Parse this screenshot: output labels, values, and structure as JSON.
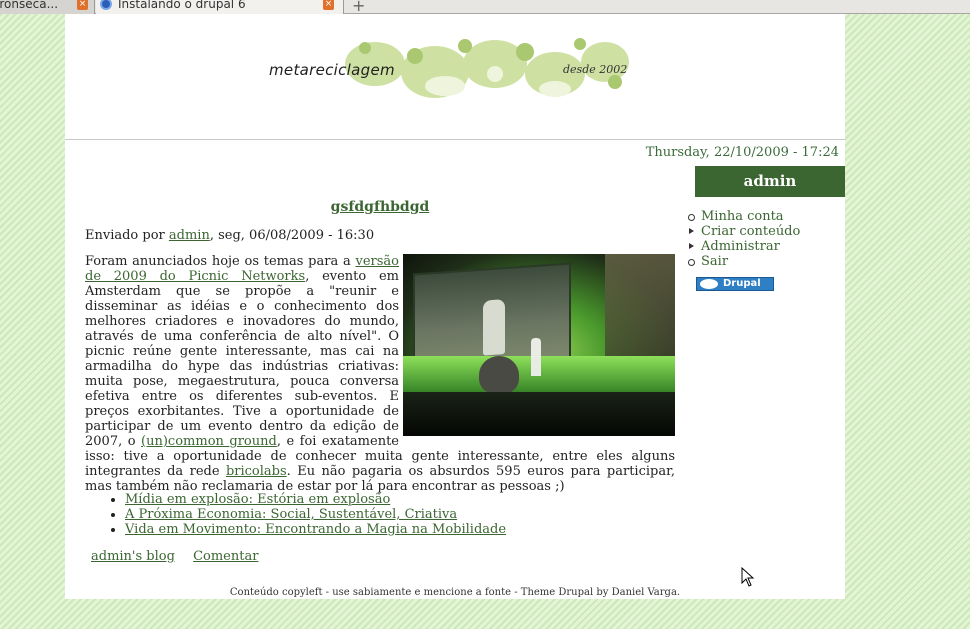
{
  "browser": {
    "tabs": [
      {
        "label": "eronseca..."
      },
      {
        "label": "Instalando o drupal 6"
      }
    ]
  },
  "site": {
    "name": "metareciclagem",
    "since": "desde 2002",
    "date": "Thursday, 22/10/2009 - 17:24"
  },
  "node": {
    "title": "gsfdgfhbdgd",
    "submitted_prefix": "Enviado por ",
    "author": "admin",
    "submitted_suffix": ", seg, 06/08/2009 - 16:30",
    "p1": "Foram anunciados hoje os temas para a ",
    "link1": "versão de 2009 do Picnic Networks",
    "p2": ", evento em Amsterdam que se propõe a \"reunir e disseminar as idéias e o conhecimento dos melhores criadores e inovadores do mundo, através de uma conferência de alto nível\". O picnic reúne gente interessante, mas cai na armadilha do hype das indústrias criativas: muita pose, megaestrutura, pouca conversa efetiva entre os diferentes sub-eventos. E preços exorbitantes. Tive a oportunidade de participar de um evento dentro da edição de 2007, o ",
    "link2": "(un)common ground",
    "p3": ", e foi exatamente isso: tive a oportunidade de conhecer muita gente interessante, entre eles alguns integrantes da rede ",
    "link3": "bricolabs",
    "p4": ". Eu não pagaria os absurdos 595 euros para participar, mas também não reclamaria de estar por lá para encontrar as pessoas ;)",
    "links": [
      "Mídia em explosão: Estória em explosão",
      "A Próxima Economia: Social, Sustentável, Criativa",
      "Vida em Movimento: Encontrando a Magia na Mobilidade"
    ],
    "blog_link": "admin's blog",
    "comment_link": "Comentar"
  },
  "sidebar": {
    "block_title": "admin",
    "menu": [
      "Minha conta",
      "Criar conteúdo",
      "Administrar",
      "Sair"
    ],
    "badge": "Drupal"
  },
  "footer": {
    "text": "Conteúdo copyleft - use sabiamente e mencione a fonte - Theme Drupal by Daniel Varga."
  }
}
